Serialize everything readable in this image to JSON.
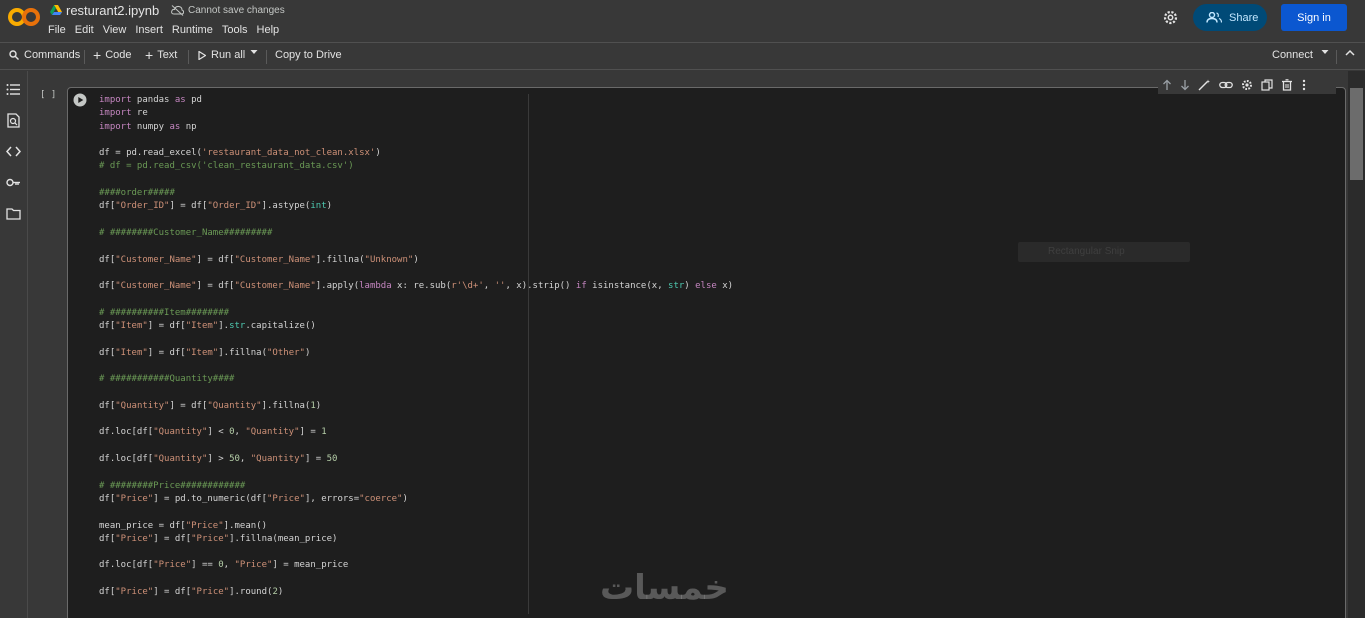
{
  "header": {
    "notebook_title": "resturant2.ipynb",
    "save_status": "Cannot save changes",
    "menu": [
      "File",
      "Edit",
      "View",
      "Insert",
      "Runtime",
      "Tools",
      "Help"
    ],
    "share_label": "Share",
    "signin_label": "Sign in"
  },
  "toolbar": {
    "commands_label": "Commands",
    "code_label": "Code",
    "text_label": "Text",
    "run_all_label": "Run all",
    "copy_drive_label": "Copy to Drive",
    "connect_label": "Connect"
  },
  "cell": {
    "bracket": "[ ]",
    "snip_label": "Rectangular Snip"
  },
  "watermark": "خمسات",
  "code_lines": [
    "import pandas as pd",
    "import re",
    "import numpy as np",
    "",
    "df = pd.read_excel('restaurant_data_not_clean.xlsx')",
    "# df = pd.read_csv('clean_restaurant_data.csv')",
    "",
    "####order#####",
    "df[\"Order_ID\"] = df[\"Order_ID\"].astype(int)",
    "",
    "# ########Customer_Name#########",
    "",
    "df[\"Customer_Name\"] = df[\"Customer_Name\"].fillna(\"Unknown\")",
    "",
    "df[\"Customer_Name\"] = df[\"Customer_Name\"].apply(lambda x: re.sub(r'\\d+', '', x).strip() if isinstance(x, str) else x)",
    "",
    "# ##########Item########",
    "df[\"Item\"] = df[\"Item\"].str.capitalize()",
    "",
    "df[\"Item\"] = df[\"Item\"].fillna(\"Other\")",
    "",
    "# ###########Quantity####",
    "",
    "df[\"Quantity\"] = df[\"Quantity\"].fillna(1)",
    "",
    "df.loc[df[\"Quantity\"] < 0, \"Quantity\"] = 1",
    "",
    "df.loc[df[\"Quantity\"] > 50, \"Quantity\"] = 50",
    "",
    "# ########Price############",
    "df[\"Price\"] = pd.to_numeric(df[\"Price\"], errors=\"coerce\")",
    "",
    "mean_price = df[\"Price\"].mean()",
    "df[\"Price\"] = df[\"Price\"].fillna(mean_price)",
    "",
    "df.loc[df[\"Price\"] == 0, \"Price\"] = mean_price",
    "",
    "df[\"Price\"] = df[\"Price\"].round(2)"
  ]
}
